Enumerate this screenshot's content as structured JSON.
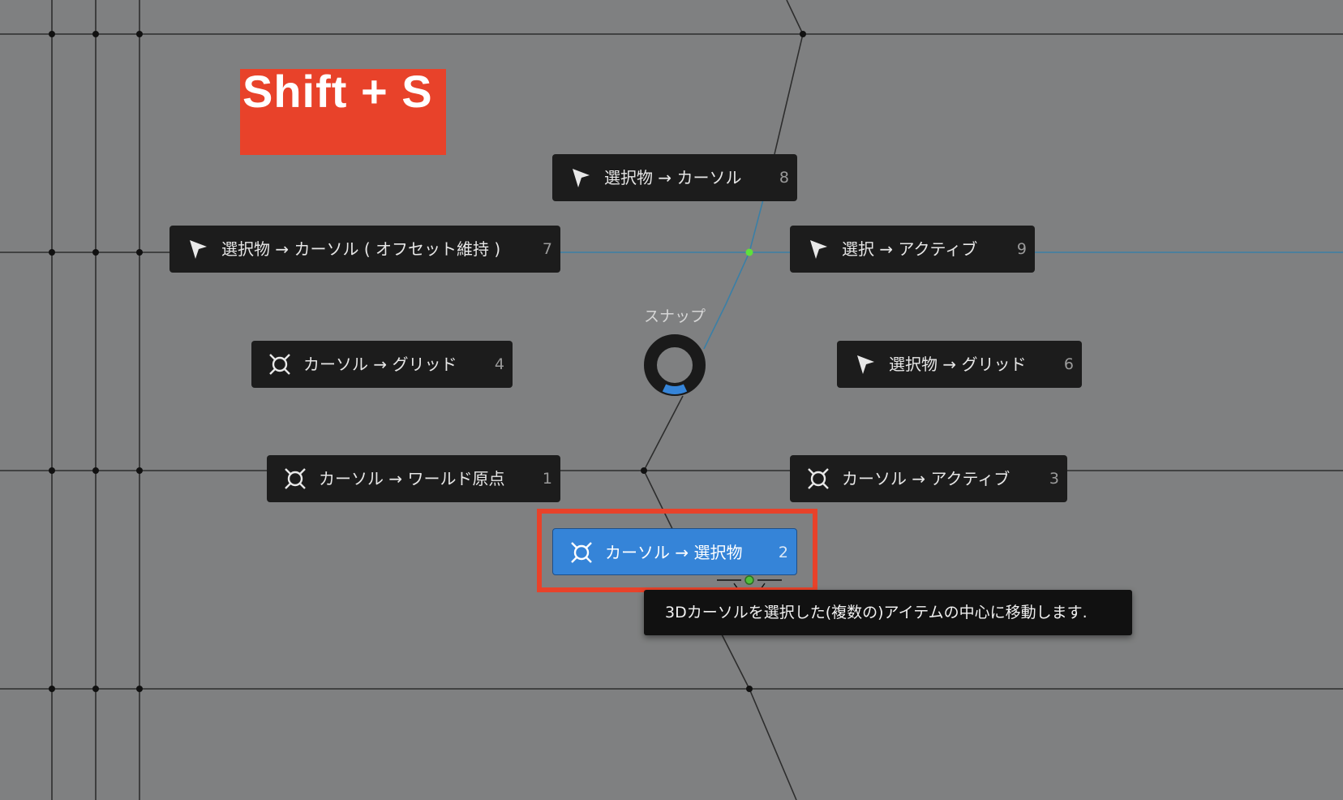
{
  "hotkey_label": "Shift + S",
  "pie_menu": {
    "title": "スナップ",
    "items": [
      {
        "label": "選択物 → カーソル",
        "key": "8",
        "icon": "selection-arrow-icon"
      },
      {
        "label": "選択物 → カーソル ( オフセット維持 )",
        "key": "7",
        "icon": "selection-arrow-icon"
      },
      {
        "label": "選択 → アクティブ",
        "key": "9",
        "icon": "selection-arrow-icon"
      },
      {
        "label": "カーソル → グリッド",
        "key": "4",
        "icon": "3d-cursor-icon"
      },
      {
        "label": "選択物 → グリッド",
        "key": "6",
        "icon": "selection-arrow-icon"
      },
      {
        "label": "カーソル → ワールド原点",
        "key": "1",
        "icon": "3d-cursor-icon"
      },
      {
        "label": "カーソル → アクティブ",
        "key": "3",
        "icon": "3d-cursor-icon"
      },
      {
        "label": "カーソル → 選択物",
        "key": "2",
        "icon": "3d-cursor-icon",
        "active": true
      }
    ]
  },
  "tooltip": "3Dカーソルを選択した(複数の)アイテムの中心に移動します.",
  "colors": {
    "viewport_bg": "#7f8081",
    "menu_item_bg": "#1c1c1c",
    "active_item_bg": "#3584d8",
    "highlight_red": "#e8422a"
  }
}
